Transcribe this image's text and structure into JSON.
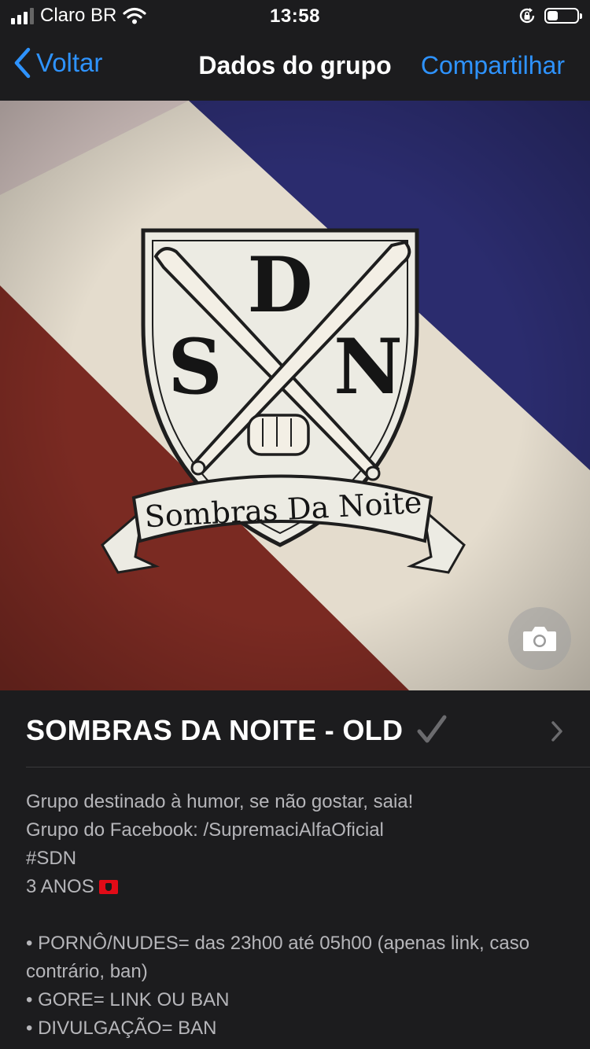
{
  "status_bar": {
    "carrier": "Claro BR",
    "time": "13:58",
    "battery_level": 0.35
  },
  "nav": {
    "back_label": "Voltar",
    "title": "Dados do grupo",
    "share_label": "Compartilhar"
  },
  "group": {
    "name": "SOMBRAS DA NOITE - OLD",
    "verified_mark": "✓",
    "photo_letters": {
      "top": "D",
      "left": "S",
      "right": "N"
    },
    "photo_banner": "Sombras Da Noite",
    "description_lines": [
      "Grupo destinado à humor, se não gostar, saia!",
      "Grupo do Facebook: /SupremaciAlfaOficial",
      "#SDN",
      "3 ANOS",
      "",
      "• PORNÔ/NUDES= das 23h00 até 05h00 (apenas link, caso contrário, ban)",
      "• GORE= LINK OU BAN",
      "• DIVULGAÇÃO= BAN"
    ]
  },
  "colors": {
    "accent": "#2e93ff",
    "background": "#1c1c1e",
    "photo_red": "#7a2a22",
    "photo_blue": "#2b2c6e",
    "photo_cream": "#e4dccd"
  }
}
